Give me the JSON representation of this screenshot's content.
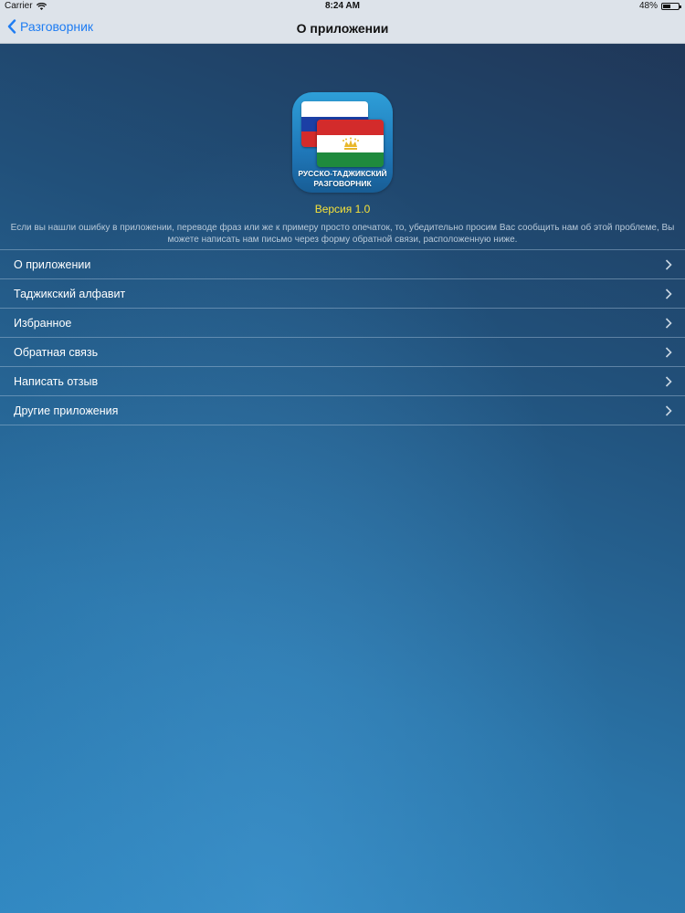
{
  "status_bar": {
    "carrier": "Carrier",
    "time": "8:24 AM",
    "battery": "48%",
    "battery_level": 0.48
  },
  "nav": {
    "back_label": "Разговорник",
    "title": "О приложении"
  },
  "app": {
    "icon_caption_line1": "РУССКО-ТАДЖИКСКИЙ",
    "icon_caption_line2": "РАЗГОВОРНИК",
    "version": "Версия 1.0",
    "description": "Если вы нашли ошибку в приложении, переводе фраз или же к примеру просто опечаток, то, убедительно просим Вас сообщить нам об этой проблеме, Вы можете написать нам письмо через форму обратной связи, расположенную ниже."
  },
  "menu": {
    "items": [
      {
        "label": "О приложении"
      },
      {
        "label": "Таджикский алфавит"
      },
      {
        "label": "Избранное"
      },
      {
        "label": "Обратная связь"
      },
      {
        "label": "Написать отзыв"
      },
      {
        "label": "Другие приложения"
      }
    ]
  },
  "colors": {
    "accent": "#1e7cf2",
    "version_text": "#f6e23a",
    "flag_ru": [
      "#ffffff",
      "#1b3fa5",
      "#d32b2b"
    ],
    "flag_tj": [
      "#d32b2b",
      "#ffffff",
      "#1f8a3d"
    ]
  },
  "icons": {
    "back": "chevron-left-icon",
    "wifi": "wifi-icon",
    "battery": "battery-icon",
    "row": "chevron-right-icon"
  }
}
